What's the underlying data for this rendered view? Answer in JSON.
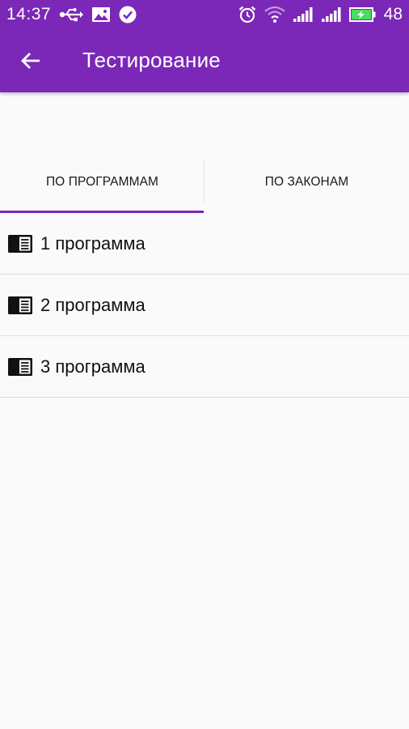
{
  "status_bar": {
    "time": "14:37",
    "battery_percent": "48",
    "icons_left": [
      "usb-icon",
      "image-icon",
      "check-circle-icon"
    ],
    "icons_right": [
      "alarm-icon",
      "wifi-icon",
      "signal-icon",
      "signal-icon",
      "battery-charging-icon"
    ]
  },
  "app_bar": {
    "title": "Тестирование",
    "back_icon": "arrow-back-icon"
  },
  "tabs": [
    {
      "label": "ПО ПРОГРАММАМ",
      "selected": true
    },
    {
      "label": "ПО ЗАКОНАМ",
      "selected": false
    }
  ],
  "list": {
    "icon": "book-list-icon",
    "items": [
      {
        "label": "1 программа"
      },
      {
        "label": "2 программа"
      },
      {
        "label": "3 программа"
      }
    ]
  },
  "colors": {
    "primary": "#7b27b8",
    "background": "#fafafa",
    "battery_fill": "#4cd964"
  }
}
